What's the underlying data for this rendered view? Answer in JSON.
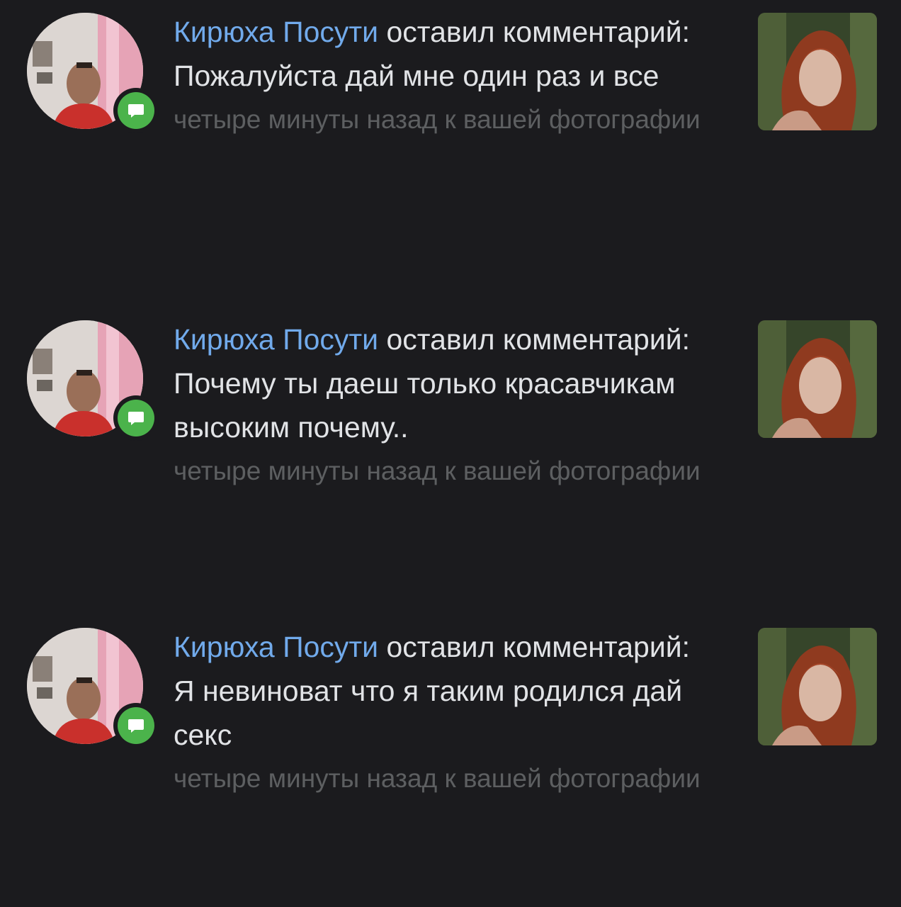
{
  "notifications": [
    {
      "author": "Кирюха Посути",
      "action": "оставил комментарий:",
      "comment": "Пожалуйста дай мне один раз и все",
      "time_context": "четыре минуты назад к вашей фотографии"
    },
    {
      "author": "Кирюха Посути",
      "action": "оставил комментарий:",
      "comment": "Почему ты даеш только красавчикам высоким почему..",
      "time_context": "четыре минуты назад к вашей фотографии"
    },
    {
      "author": "Кирюха Посути",
      "action": "оставил комментарий:",
      "comment": "Я невиноват что я таким родился дай секс",
      "time_context": "четыре минуты назад к вашей фотографии"
    }
  ],
  "colors": {
    "background": "#1b1b1e",
    "author_link": "#71aaeb",
    "primary_text": "#e1e3e6",
    "secondary_text": "#5d5f61",
    "comment_badge": "#4bb34b"
  },
  "icons": {
    "badge": "comment-bubble-icon"
  }
}
